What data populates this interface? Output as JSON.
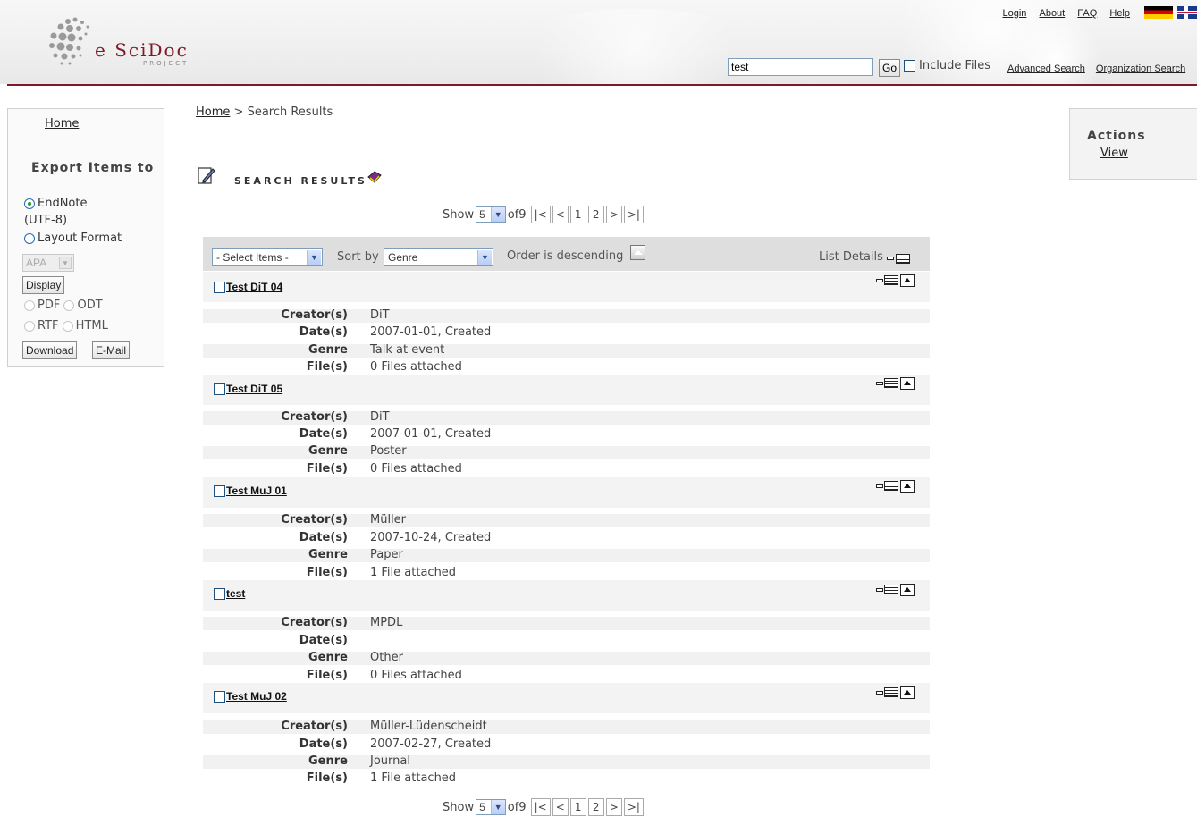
{
  "header": {
    "logo_text": "e SciDoc",
    "logo_sub": "PROJECT",
    "top_links": [
      "Login",
      "About",
      "FAQ",
      "Help"
    ],
    "search_value": "test",
    "go_label": "Go",
    "include_files_label": "Include Files",
    "advanced_search": "Advanced Search",
    "organization_search": "Organization Search"
  },
  "left_panel": {
    "home": "Home",
    "export_title": "Export Items to",
    "endnote": "EndNote",
    "utf": "(UTF-8)",
    "layout_format": "Layout Format",
    "apa": "APA",
    "display": "Display",
    "pdf": "PDF",
    "odt": "ODT",
    "rtf": "RTF",
    "html": "HTML",
    "download": "Download",
    "email": "E-Mail"
  },
  "breadcrumb": {
    "home": "Home",
    "sep": " > ",
    "current": "Search Results"
  },
  "results_title": "Search Results",
  "pager": {
    "show": "Show",
    "per_page": "5",
    "of": "of9",
    "buttons": [
      "|<",
      "<",
      "1",
      "2",
      ">",
      ">|"
    ]
  },
  "toolbar": {
    "select_items": "- Select Items -",
    "sort_by": "Sort by",
    "sort_value": "Genre",
    "order": "Order is descending",
    "list_details": "List Details"
  },
  "labels": {
    "creator": "Creator(s)",
    "date": "Date(s)",
    "genre": "Genre",
    "files": "File(s)"
  },
  "items": [
    {
      "title": "Test DiT 04",
      "creator": "DiT",
      "date": "2007-01-01, Created",
      "genre": "Talk at event",
      "files": "0 Files attached"
    },
    {
      "title": "Test DiT 05",
      "creator": "DiT",
      "date": "2007-01-01, Created",
      "genre": "Poster",
      "files": "0 Files attached"
    },
    {
      "title": "Test MuJ 01",
      "creator": "Müller",
      "date": "2007-10-24, Created",
      "genre": "Paper",
      "files": "1 File attached"
    },
    {
      "title": "test",
      "creator": "MPDL",
      "date": "",
      "genre": "Other",
      "files": "0 Files attached"
    },
    {
      "title": "Test MuJ 02",
      "creator": "Müller-Lüdenscheidt",
      "date": "2007-02-27, Created",
      "genre": "Journal",
      "files": "1 File attached"
    }
  ],
  "right_panel": {
    "actions": "Actions",
    "view": "View"
  },
  "colors": {
    "brand": "#7d1a2a",
    "toolbar": "#dedede",
    "row_shade": "#f1f1f1"
  }
}
